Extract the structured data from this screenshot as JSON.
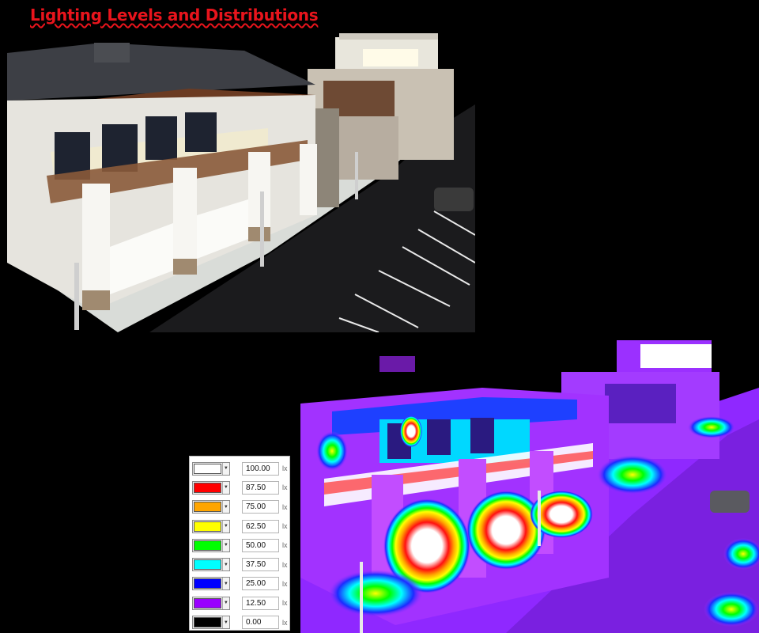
{
  "title": "Lighting Levels and Distributions",
  "legend": {
    "unit": "lx",
    "levels": [
      {
        "value": "100.00",
        "color": "#ffffff"
      },
      {
        "value": "87.50",
        "color": "#ff0000"
      },
      {
        "value": "75.00",
        "color": "#ffa500"
      },
      {
        "value": "62.50",
        "color": "#ffff00"
      },
      {
        "value": "50.00",
        "color": "#00ff00"
      },
      {
        "value": "37.50",
        "color": "#00ffff"
      },
      {
        "value": "25.00",
        "color": "#0000ff"
      },
      {
        "value": "12.50",
        "color": "#9900ff"
      },
      {
        "value": "0.00",
        "color": "#000000"
      }
    ]
  }
}
